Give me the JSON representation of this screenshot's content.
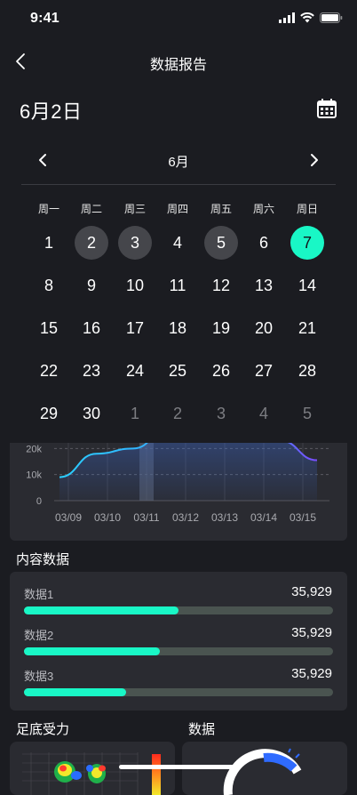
{
  "status": {
    "time": "9:41"
  },
  "nav": {
    "title": "数据报告"
  },
  "date_title": "6月2日",
  "calendar": {
    "month": "6月",
    "weekdays": [
      "周一",
      "周二",
      "周三",
      "周四",
      "周五",
      "周六",
      "周日"
    ],
    "rows": [
      [
        "1",
        "2",
        "3",
        "4",
        "5",
        "6",
        "7"
      ],
      [
        "8",
        "9",
        "10",
        "11",
        "12",
        "13",
        "14"
      ],
      [
        "15",
        "16",
        "17",
        "18",
        "19",
        "20",
        "21"
      ],
      [
        "22",
        "23",
        "24",
        "25",
        "26",
        "27",
        "28"
      ],
      [
        "29",
        "30",
        "1",
        "2",
        "3",
        "4",
        "5"
      ]
    ],
    "highlighted_days": [
      "2",
      "3",
      "5"
    ],
    "selected_day": "7",
    "accent_color": "#19f7c6"
  },
  "chart_data": {
    "type": "line",
    "x": [
      "03/09",
      "03/10",
      "03/11",
      "03/12",
      "03/13",
      "03/14",
      "03/15"
    ],
    "y_ticks": [
      "0",
      "10k",
      "20k"
    ],
    "series": [
      {
        "values": [
          9000,
          18000,
          20000,
          28000,
          25000,
          29000,
          23000,
          15500
        ],
        "colors": [
          "#2ad0ff",
          "#7b4dff"
        ]
      }
    ],
    "highlight_x": "03/11",
    "ylim": [
      0,
      30000
    ]
  },
  "content": {
    "title": "内容数据",
    "rows": [
      {
        "label": "数据1",
        "value": "35,929",
        "progress": 0.5
      },
      {
        "label": "数据2",
        "value": "35,929",
        "progress": 0.44
      },
      {
        "label": "数据3",
        "value": "35,929",
        "progress": 0.33
      }
    ]
  },
  "bottom": {
    "left_title": "足底受力",
    "right_title": "数据"
  }
}
